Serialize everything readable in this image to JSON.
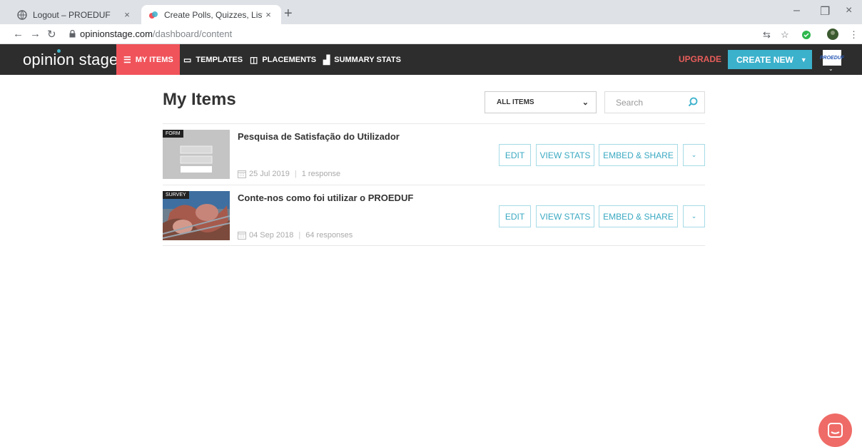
{
  "browser": {
    "tabs": [
      {
        "title": "Logout – PROEDUF",
        "close": "×"
      },
      {
        "title": "Create Polls, Quizzes, Lists and m",
        "close": "×"
      }
    ],
    "new_tab": "+",
    "url_host": "opinionstage.com",
    "url_path": "/dashboard/content",
    "window_controls": {
      "minimize": "–",
      "restore": "❐",
      "close": "×"
    }
  },
  "nav": {
    "logo": "opinion stage",
    "items": [
      {
        "label": "MY ITEMS",
        "icon": "list-icon"
      },
      {
        "label": "TEMPLATES",
        "icon": "templates-icon"
      },
      {
        "label": "PLACEMENTS",
        "icon": "placements-icon"
      },
      {
        "label": "SUMMARY STATS",
        "icon": "stats-icon"
      }
    ],
    "upgrade": "UPGRADE",
    "create_new": "CREATE NEW",
    "avatar_text": "PROEDUF"
  },
  "main": {
    "title": "My Items",
    "filter_value": "ALL ITEMS",
    "search_placeholder": "Search",
    "items": [
      {
        "type": "FORM",
        "title": "Pesquisa de Satisfação do Utilizador",
        "date": "25 Jul 2019",
        "responses": "1 response"
      },
      {
        "type": "SURVEY",
        "title": "Conte-nos como foi utilizar o PROEDUF",
        "date": "04 Sep 2018",
        "responses": "64 responses"
      }
    ],
    "buttons": {
      "edit": "EDIT",
      "view_stats": "VIEW STATS",
      "embed_share": "EMBED & SHARE",
      "more": "⌄"
    }
  },
  "colors": {
    "accent_red": "#f0535a",
    "accent_blue": "#3bb1cc",
    "nav_bg": "#2d2d2d"
  }
}
